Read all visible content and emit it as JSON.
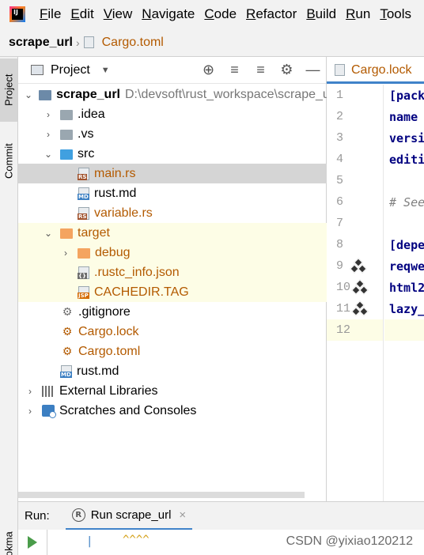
{
  "menu": {
    "logo_text": "IJ",
    "items": [
      {
        "first": "F",
        "rest": "ile"
      },
      {
        "first": "E",
        "rest": "dit"
      },
      {
        "first": "V",
        "rest": "iew"
      },
      {
        "first": "N",
        "rest": "avigate"
      },
      {
        "first": "C",
        "rest": "ode"
      },
      {
        "first": "R",
        "rest": "efactor"
      },
      {
        "first": "B",
        "rest": "uild"
      },
      {
        "first": "R",
        "rest": "un"
      },
      {
        "first": "T",
        "rest": "ools"
      }
    ]
  },
  "breadcrumb": {
    "project": "scrape_url",
    "separator": "›",
    "file": "Cargo.toml"
  },
  "tool_strip": {
    "project_tab": "Project",
    "commit_tab": "Commit",
    "bookmarks_tab": "Bookmarks"
  },
  "project_panel": {
    "title": "Project",
    "dropdown_icon": "▼",
    "tools": [
      "⊕",
      "≡",
      "≡",
      "⚙",
      "—"
    ],
    "tree": [
      {
        "label": "scrape_url",
        "path": "D:\\devsoft\\rust_workspace\\scrape_url"
      },
      {
        "label": ".idea"
      },
      {
        "label": ".vs"
      },
      {
        "label": "src"
      },
      {
        "label": "main.rs",
        "tag": "RS"
      },
      {
        "label": "rust.md",
        "tag": "MD"
      },
      {
        "label": "variable.rs",
        "tag": "RS"
      },
      {
        "label": "target"
      },
      {
        "label": "debug"
      },
      {
        "label": ".rustc_info.json",
        "tag": "{}"
      },
      {
        "label": "CACHEDIR.TAG",
        "tag": "JSP"
      },
      {
        "label": ".gitignore"
      },
      {
        "label": "Cargo.lock"
      },
      {
        "label": "Cargo.toml"
      },
      {
        "label": "rust.md",
        "tag": "MD"
      },
      {
        "label": "External Libraries"
      },
      {
        "label": "Scratches and Consoles"
      }
    ]
  },
  "editor": {
    "tab_label": "Cargo.lock",
    "line_numbers": [
      "1",
      "2",
      "3",
      "4",
      "5",
      "6",
      "7",
      "8",
      "9",
      "10",
      "11",
      "12"
    ],
    "lines": [
      "[pack",
      "name",
      "versi",
      "editi",
      "",
      "# See",
      "",
      "[depe",
      "reqwe",
      "html2",
      "lazy_",
      ""
    ]
  },
  "run": {
    "label": "Run:",
    "tab_label": "Run scrape_url",
    "close": "×",
    "cursor": "|",
    "carets": "^^^^"
  },
  "watermark": "CSDN @yixiao120212",
  "colors": {
    "file_orange": "#b35a00",
    "selection": "#d5d5d5",
    "excluded_bg": "#fdfde6",
    "accent_blue": "#4083c9"
  }
}
